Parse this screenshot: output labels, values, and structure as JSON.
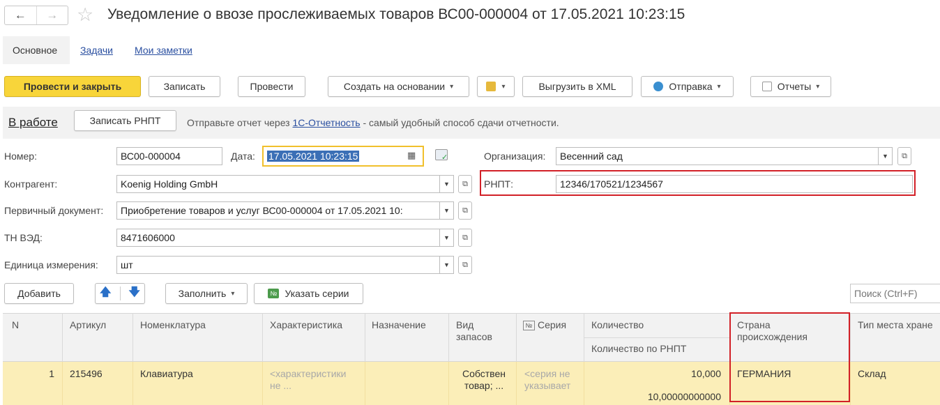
{
  "header": {
    "back_arrow": "←",
    "forward_arrow": "→",
    "star": "☆",
    "title": "Уведомление о ввозе прослеживаемых товаров ВС00-000004 от 17.05.2021 10:23:15"
  },
  "sections": {
    "main": "Основное",
    "tasks": "Задачи",
    "notes": "Мои заметки"
  },
  "toolbar": {
    "post_close": "Провести и закрыть",
    "save": "Записать",
    "post": "Провести",
    "create_based": "Создать на основании",
    "export_xml": "Выгрузить в XML",
    "send": "Отправка",
    "reports": "Отчеты"
  },
  "status": {
    "state": "В работе",
    "save_rnpt": "Записать РНПТ",
    "note_before": "Отправьте отчет через ",
    "note_link": "1С-Отчетность",
    "note_after": " - самый удобный способ сдачи отчетности."
  },
  "form": {
    "number_label": "Номер:",
    "number_value": "ВС00-000004",
    "date_label": "Дата:",
    "date_value": "17.05.2021 10:23:15",
    "org_label": "Организация:",
    "org_value": "Весенний сад",
    "counterparty_label": "Контрагент:",
    "counterparty_value": "Koenig Holding GmbH",
    "rnpt_label": "РНПТ:",
    "rnpt_value": "12346/170521/1234567",
    "primary_doc_label": "Первичный документ:",
    "primary_doc_value": "Приобретение товаров и услуг ВС00-000004 от 17.05.2021 10:",
    "tnved_label": "ТН ВЭД:",
    "tnved_value": "8471606000",
    "unit_label": "Единица измерения:",
    "unit_value": "шт"
  },
  "table_toolbar": {
    "add": "Добавить",
    "fill": "Заполнить",
    "series": "Указать серии",
    "search_placeholder": "Поиск (Ctrl+F)"
  },
  "table": {
    "columns": {
      "n": "N",
      "article": "Артикул",
      "nomenclature": "Номенклатура",
      "characteristic": "Характеристика",
      "purpose": "Назначение",
      "stock_type_1": "Вид",
      "stock_type_2": "запасов",
      "series": "Серия",
      "quantity": "Количество",
      "quantity_rnpt": "Количество по РНПТ",
      "country_1": "Страна",
      "country_2": "происхождения",
      "place_type": "Тип места хране"
    },
    "rows": [
      {
        "n": "1",
        "article": "215496",
        "nomenclature": "Клавиатура",
        "characteristic_1": "<характеристики",
        "characteristic_2": "не ...",
        "stock_type_1": "Собствен",
        "stock_type_2": "товар; ...",
        "series_1": "<серия не",
        "series_2": "указывает",
        "quantity": "10,000",
        "quantity_rnpt": "10,00000000000",
        "country": "ГЕРМАНИЯ",
        "place_type": "Склад"
      }
    ]
  },
  "colors": {
    "primary_button": "#f8d53a",
    "highlight_row": "#fbeeb8",
    "red_frame": "#d22027",
    "link": "#2a4fa0"
  }
}
